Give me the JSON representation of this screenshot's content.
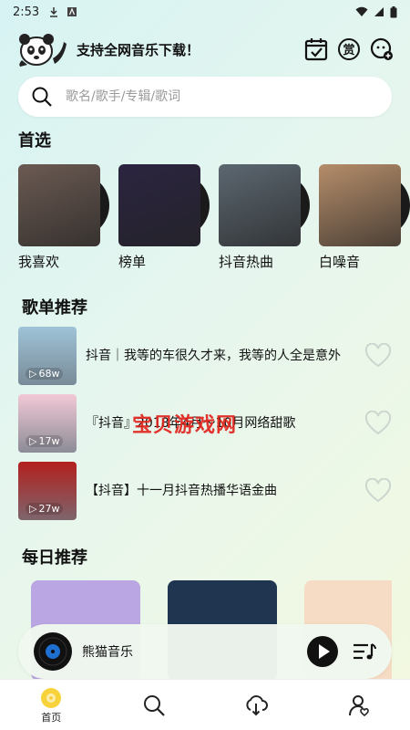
{
  "status_bar": {
    "time": "2:53"
  },
  "header": {
    "title": "支持全网音乐下载！"
  },
  "search": {
    "placeholder": "歌名/歌手/专辑/歌词"
  },
  "sections": {
    "featured": "首选",
    "playlists": "歌单推荐",
    "daily": "每日推荐"
  },
  "featured": [
    {
      "label": "我喜欢",
      "color": "#6b5a52"
    },
    {
      "label": "榜单",
      "color": "#2b2440"
    },
    {
      "label": "抖音热曲",
      "color": "#5c6770"
    },
    {
      "label": "白噪音",
      "color": "#b58d6a"
    }
  ],
  "playlists": [
    {
      "title": "抖音｜我等的车很久才来，我等的人全是意外",
      "plays": "68w",
      "color": "#9fc3d8"
    },
    {
      "title": "『抖音』2018年4月～10月网络甜歌",
      "plays": "17w",
      "color": "#f2c9d6"
    },
    {
      "title": "【抖音】十一月抖音热播华语金曲",
      "plays": "27w",
      "color": "#b3201e"
    }
  ],
  "daily": [
    {
      "color": "#b9a6e2"
    },
    {
      "color": "#1f3550"
    },
    {
      "color": "#f6dcc4"
    }
  ],
  "watermark": "宝贝游戏网",
  "player": {
    "song": "熊猫音乐"
  },
  "bottom_nav": [
    {
      "label": "首页",
      "icon": "home-icon",
      "active": true
    },
    {
      "label": "",
      "icon": "search-icon"
    },
    {
      "label": "",
      "icon": "download-icon"
    },
    {
      "label": "",
      "icon": "profile-icon"
    }
  ]
}
